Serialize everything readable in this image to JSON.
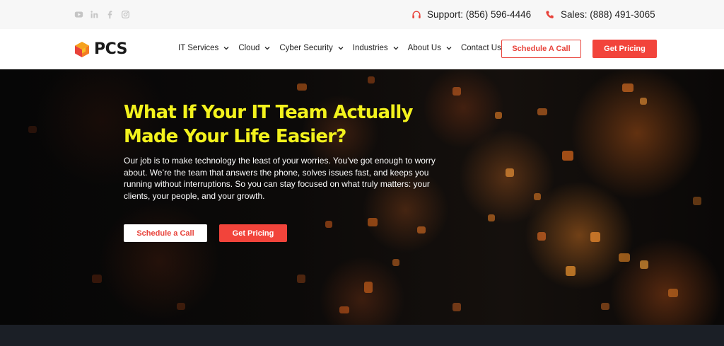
{
  "topbar": {
    "social_icons": [
      "youtube-icon",
      "linkedin-icon",
      "facebook-icon",
      "instagram-icon"
    ],
    "support": "Support: (856) 596-4446",
    "sales": "Sales: (888) 491-3065"
  },
  "header": {
    "logo_text": "PCS",
    "nav": [
      {
        "label": "IT Services"
      },
      {
        "label": "Cloud"
      },
      {
        "label": "Cyber Security"
      },
      {
        "label": "Industries"
      },
      {
        "label": "About Us"
      },
      {
        "label": "Contact Us"
      }
    ],
    "schedule_label": "Schedule A Call",
    "pricing_label": "Get Pricing"
  },
  "hero": {
    "title_line1": "What If Your IT Team Actually",
    "title_line2": "Made Your Life Easier?",
    "body": "Our job is to make technology the least of your worries. You’ve got enough to worry about. We’re the team that answers the phone, solves issues fast, and keeps you running without interruptions. So you can stay focused on what truly matters: your clients, your people, and your growth.",
    "btn_schedule": "Schedule a Call",
    "btn_pricing": "Get Pricing"
  },
  "colors": {
    "accent": "#f2443b",
    "headline": "#f3f21d",
    "topbar_bg": "#f7f7f7",
    "footer_band": "#1b1f26"
  }
}
